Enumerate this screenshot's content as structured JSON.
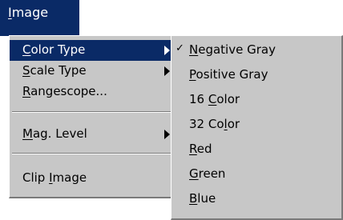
{
  "menubar": {
    "label_mnemonic": "I",
    "label_rest": "mage"
  },
  "main_menu": {
    "items": [
      {
        "pre": "",
        "mnemonic": "C",
        "post": "olor Type",
        "has_submenu": true,
        "highlighted": true
      },
      {
        "pre": "",
        "mnemonic": "S",
        "post": "cale Type",
        "has_submenu": true,
        "highlighted": false
      },
      {
        "pre": "",
        "mnemonic": "R",
        "post": "angescope...",
        "has_submenu": false,
        "highlighted": false
      },
      {
        "pre": "",
        "mnemonic": "M",
        "post": "ag. Level",
        "has_submenu": true,
        "highlighted": false
      },
      {
        "pre": "Clip ",
        "mnemonic": "I",
        "post": "mage",
        "has_submenu": false,
        "highlighted": false
      }
    ]
  },
  "color_type_submenu": {
    "check_glyph": "✓",
    "items": [
      {
        "pre": "",
        "mnemonic": "N",
        "post": "egative Gray",
        "checked": true
      },
      {
        "pre": "",
        "mnemonic": "P",
        "post": "ositive Gray",
        "checked": false
      },
      {
        "pre": "16 ",
        "mnemonic": "C",
        "post": "olor",
        "checked": false
      },
      {
        "pre": "32 Co",
        "mnemonic": "l",
        "post": "or",
        "checked": false
      },
      {
        "pre": "",
        "mnemonic": "R",
        "post": "ed",
        "checked": false
      },
      {
        "pre": "",
        "mnemonic": "G",
        "post": "reen",
        "checked": false
      },
      {
        "pre": "",
        "mnemonic": "B",
        "post": "lue",
        "checked": false
      }
    ]
  },
  "colors": {
    "highlight": "#0a2a66",
    "menu_bg": "#c7c7c7",
    "highlight_text": "#ffffff"
  }
}
